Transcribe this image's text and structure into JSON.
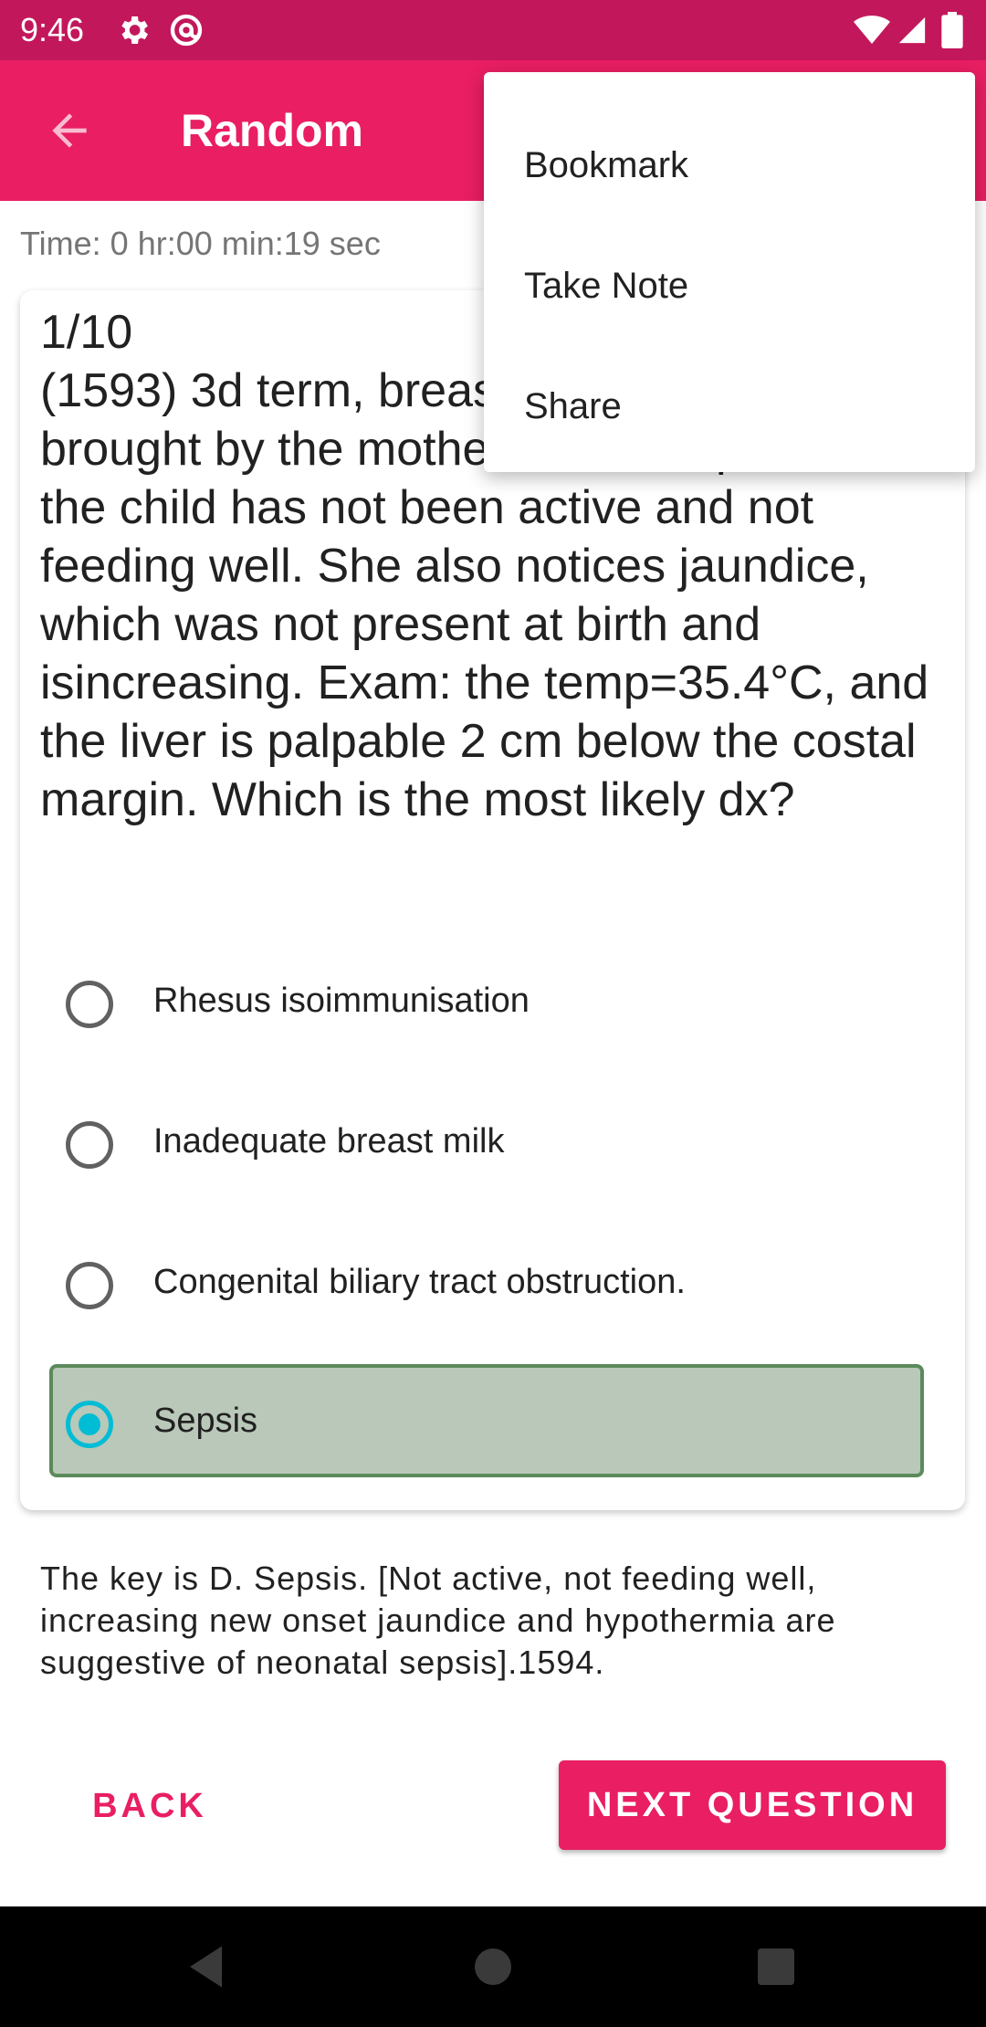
{
  "status_bar": {
    "time": "9:46",
    "icons": [
      "gear-icon",
      "at-sign-icon",
      "wifi-icon",
      "cell-signal-icon",
      "battery-icon"
    ]
  },
  "app_bar": {
    "title": "Random",
    "back_icon": "back-arrow-icon"
  },
  "timer": {
    "text": "Time: 0 hr:00 min:19 sec"
  },
  "question": {
    "number": "1/10",
    "text": "(1593) 3d term, breastfed 3 day old baby is brought by the mother. She complains that the child has not been active and not feeding well. She also notices jaundice, which was not present at birth and isincreasing. Exam: the temp=35.4°C, and the liver is palpable 2 cm below the costal margin. Which is the most likely dx?"
  },
  "options": [
    {
      "label": "Rhesus isoimmunisation",
      "selected": false
    },
    {
      "label": "Inadequate breast milk",
      "selected": false
    },
    {
      "label": "Congenital biliary tract obstruction.",
      "selected": false
    },
    {
      "label": "Sepsis",
      "selected": true
    }
  ],
  "explanation": "The key is D. Sepsis. [Not active, not feeding well, increasing new onset jaundice and hypothermia are suggestive of neonatal sepsis].1594.",
  "buttons": {
    "back": "BACK",
    "next": "NEXT QUESTION"
  },
  "menu": {
    "items": [
      "Bookmark",
      "Take Note",
      "Share"
    ]
  },
  "colors": {
    "status_bar": "#c2185b",
    "app_bar": "#e91e63",
    "accent": "#e91e63",
    "selected_option_bg": "#b9c8b9",
    "selected_option_border": "#5b8a5b",
    "radio_selected": "#00bcd4"
  },
  "nav_bar": {
    "icons": [
      "back-triangle-icon",
      "home-circle-icon",
      "recents-square-icon"
    ]
  }
}
